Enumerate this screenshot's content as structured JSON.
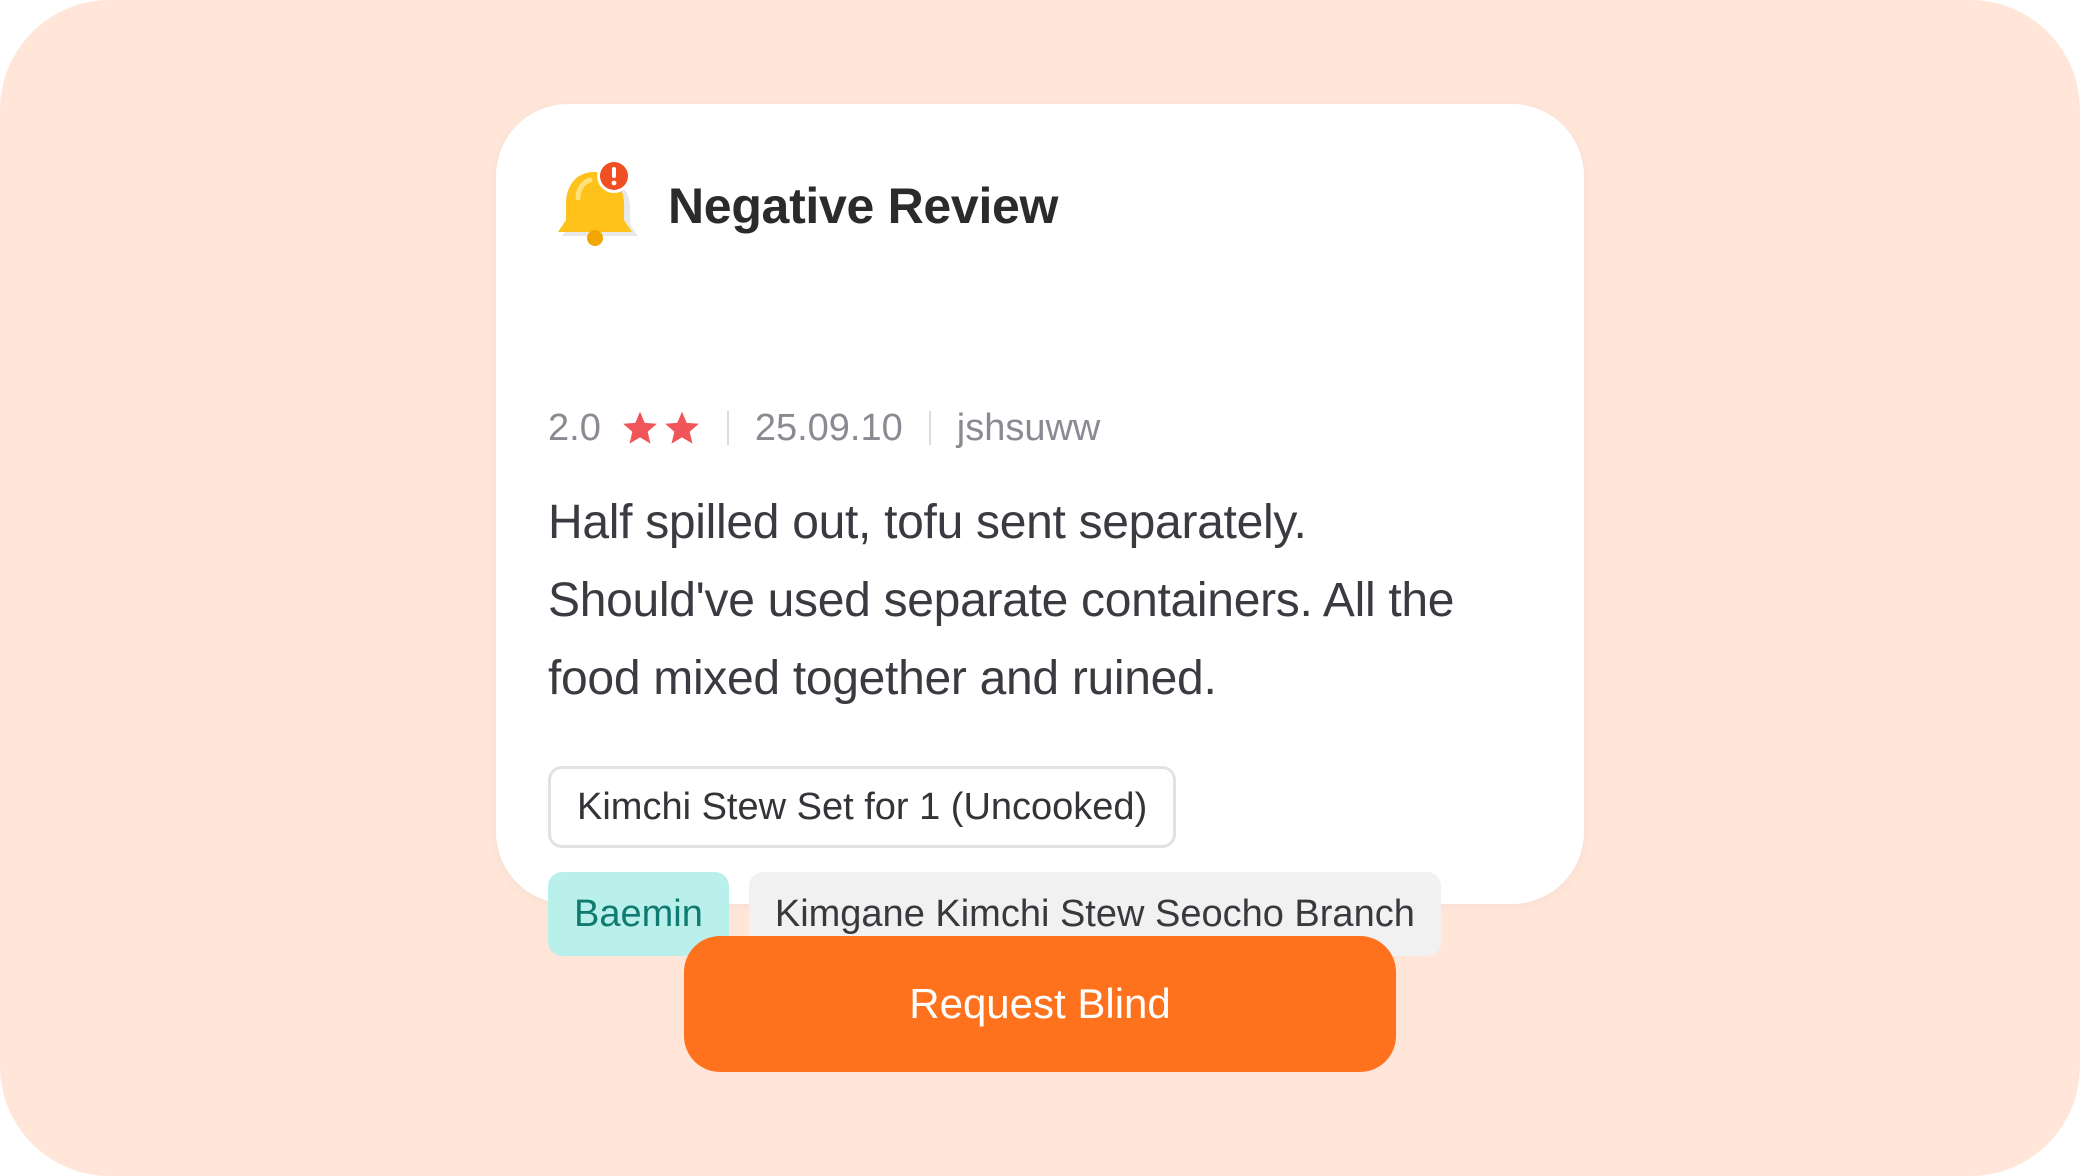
{
  "card": {
    "title": "Negative Review",
    "icon": "bell-alert-icon",
    "rating": "2.0",
    "stars_filled": 2,
    "date": "25.09.10",
    "username": "jshsuww",
    "review_text": "Half spilled out, tofu sent separately. Should've used separate containers. All the food mixed together and ruined.",
    "menu_item": "Kimchi Stew Set for 1 (Uncooked)",
    "platform_tag": "Baemin",
    "store_tag": "Kimgane Kimchi Stew Seocho Branch"
  },
  "actions": {
    "request_blind_label": "Request Blind"
  },
  "colors": {
    "background": "#ffe6d9",
    "card": "#ffffff",
    "accent_orange": "#ff721d",
    "star": "#f0555a",
    "bell": "#ffc21a",
    "badge": "#f04e23",
    "platform_tag_bg": "#b9f0ec",
    "platform_tag_text": "#0f7a70",
    "store_tag_bg": "#f1f1f2"
  }
}
